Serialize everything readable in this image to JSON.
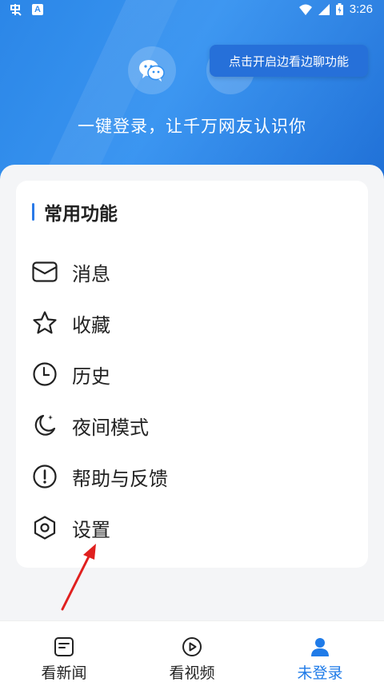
{
  "status_bar": {
    "left_icons": [
      "app-icon",
      "a-icon"
    ],
    "a_label": "A",
    "time": "3:26"
  },
  "header": {
    "tooltip": "点击开启边看边聊功能",
    "login_text": "一键登录，让千万网友认识你"
  },
  "card": {
    "title": "常用功能",
    "items": [
      {
        "label": "消息",
        "icon": "mail-icon"
      },
      {
        "label": "收藏",
        "icon": "star-icon"
      },
      {
        "label": "历史",
        "icon": "clock-icon"
      },
      {
        "label": "夜间模式",
        "icon": "moon-icon"
      },
      {
        "label": "帮助与反馈",
        "icon": "exclamation-icon"
      },
      {
        "label": "设置",
        "icon": "hexagon-settings-icon"
      }
    ]
  },
  "tabbar": {
    "items": [
      {
        "label": "看新闻",
        "icon": "news-icon",
        "active": false
      },
      {
        "label": "看视频",
        "icon": "play-icon",
        "active": false
      },
      {
        "label": "未登录",
        "icon": "user-icon",
        "active": true
      }
    ]
  },
  "colors": {
    "header_blue": "#2a86ee",
    "accent": "#1f7be8",
    "tooltip": "#2670d9"
  }
}
